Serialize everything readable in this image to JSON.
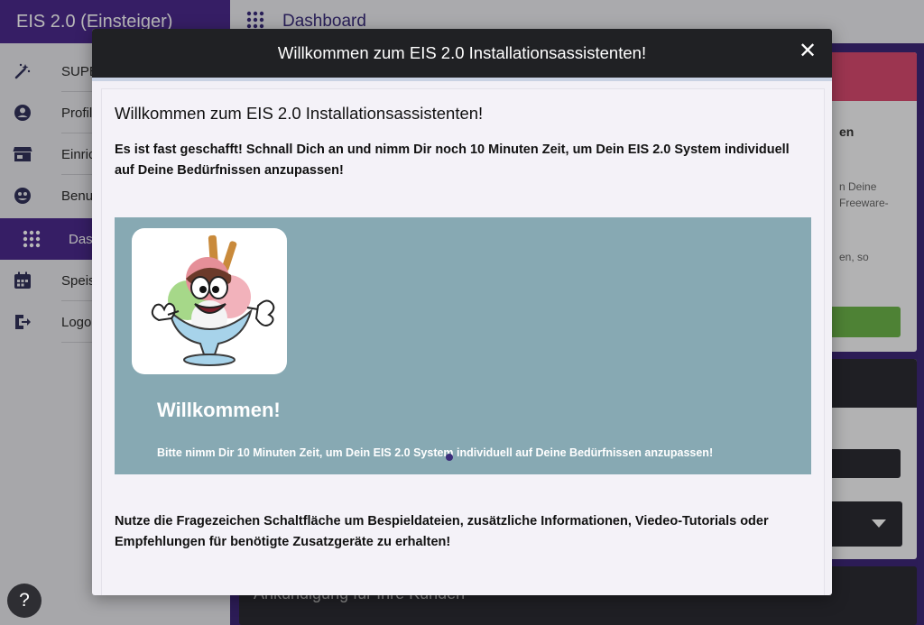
{
  "app": {
    "title": "EIS 2.0 (Einsteiger)"
  },
  "sidebar": {
    "items": [
      {
        "label": "SUPE",
        "icon": "magic-wand-icon"
      },
      {
        "label": "Profil",
        "icon": "account-circle-icon"
      },
      {
        "label": "Einric",
        "icon": "store-icon"
      },
      {
        "label": "Benu",
        "icon": "face-icon"
      },
      {
        "label": "Das",
        "icon": "dashboard-grid-icon",
        "active": true
      },
      {
        "label": "Speis",
        "icon": "calendar-icon"
      },
      {
        "label": "Logo",
        "icon": "logout-icon"
      }
    ]
  },
  "header": {
    "title": "Dashboard"
  },
  "background": {
    "card1_title": "en",
    "card1_text": "n Deine\nFreeware-",
    "card1_text2": "en, so",
    "card3_text": "Ankündigung für Ihre Kunden"
  },
  "help_button": {
    "label": "?"
  },
  "modal": {
    "header_title": "Willkommen zum EIS 2.0 Installationsassistenten!",
    "close_label": "✕",
    "heading": "Willkommen zum EIS 2.0 Installationsassistenten!",
    "intro": "Es ist fast geschafft! Schnall Dich an und nimm Dir noch 10 Minuten Zeit, um Dein EIS 2.0 System individuell auf Deine Bedürfnissen anzupassen!",
    "slide": {
      "title": "Willkommen!",
      "text": "Bitte nimm Dir 10 Minuten Zeit, um Dein EIS 2.0 System individuell auf Deine Bedürfnissen anzupassen!"
    },
    "help_text": "Nutze die Fragezeichen Schaltfläche um Bespieldateien, zusätzliche Informationen, Viedeo-Tutorials oder Empfehlungen für benötigte Zusatzgeräte zu erhalten!"
  },
  "colors": {
    "brand": "#4b2a8c",
    "modal_header": "#202124",
    "slide_bg": "#87a9b3",
    "accent_red": "#d94a6f",
    "accent_green": "#6cb54a"
  }
}
